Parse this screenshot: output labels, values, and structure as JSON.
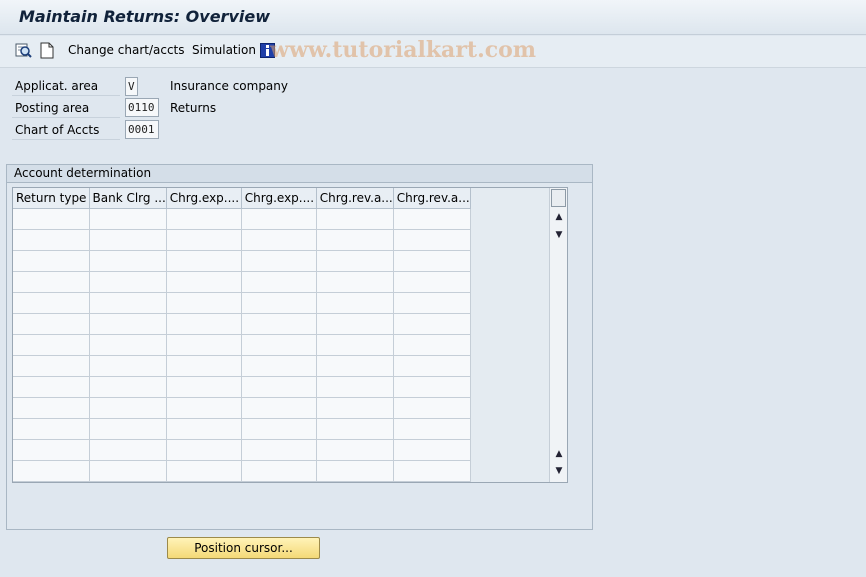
{
  "window": {
    "title": "Maintain Returns: Overview"
  },
  "toolbar": {
    "display_icon": "display-magnifier-icon",
    "new_icon": "new-document-icon",
    "change_chart_label": "Change chart/accts",
    "simulation_label": "Simulation",
    "info_icon": "info-icon"
  },
  "watermark": "www.tutorialkart.com",
  "header_fields": [
    {
      "label": "Applicat. area",
      "value": "V",
      "description": "Insurance company"
    },
    {
      "label": "Posting area",
      "value": "0110",
      "description": "Returns"
    },
    {
      "label": "Chart of Accts",
      "value": "0001",
      "description": ""
    }
  ],
  "group": {
    "title": "Account determination"
  },
  "table": {
    "columns": [
      "Return type",
      "Bank Clrg ...",
      "Chrg.exp....",
      "Chrg.exp....",
      "Chrg.rev.a...",
      "Chrg.rev.a..."
    ],
    "rows": [
      [
        "",
        "",
        "",
        "",
        "",
        ""
      ],
      [
        "",
        "",
        "",
        "",
        "",
        ""
      ],
      [
        "",
        "",
        "",
        "",
        "",
        ""
      ],
      [
        "",
        "",
        "",
        "",
        "",
        ""
      ],
      [
        "",
        "",
        "",
        "",
        "",
        ""
      ],
      [
        "",
        "",
        "",
        "",
        "",
        ""
      ],
      [
        "",
        "",
        "",
        "",
        "",
        ""
      ],
      [
        "",
        "",
        "",
        "",
        "",
        ""
      ],
      [
        "",
        "",
        "",
        "",
        "",
        ""
      ],
      [
        "",
        "",
        "",
        "",
        "",
        ""
      ],
      [
        "",
        "",
        "",
        "",
        "",
        ""
      ],
      [
        "",
        "",
        "",
        "",
        "",
        ""
      ],
      [
        "",
        "",
        "",
        "",
        "",
        ""
      ]
    ]
  },
  "buttons": {
    "position_cursor": "Position cursor..."
  },
  "colors": {
    "background": "#dfe7ef",
    "button_yellow": "#f4d977",
    "info_blue": "#1f3fa8"
  }
}
